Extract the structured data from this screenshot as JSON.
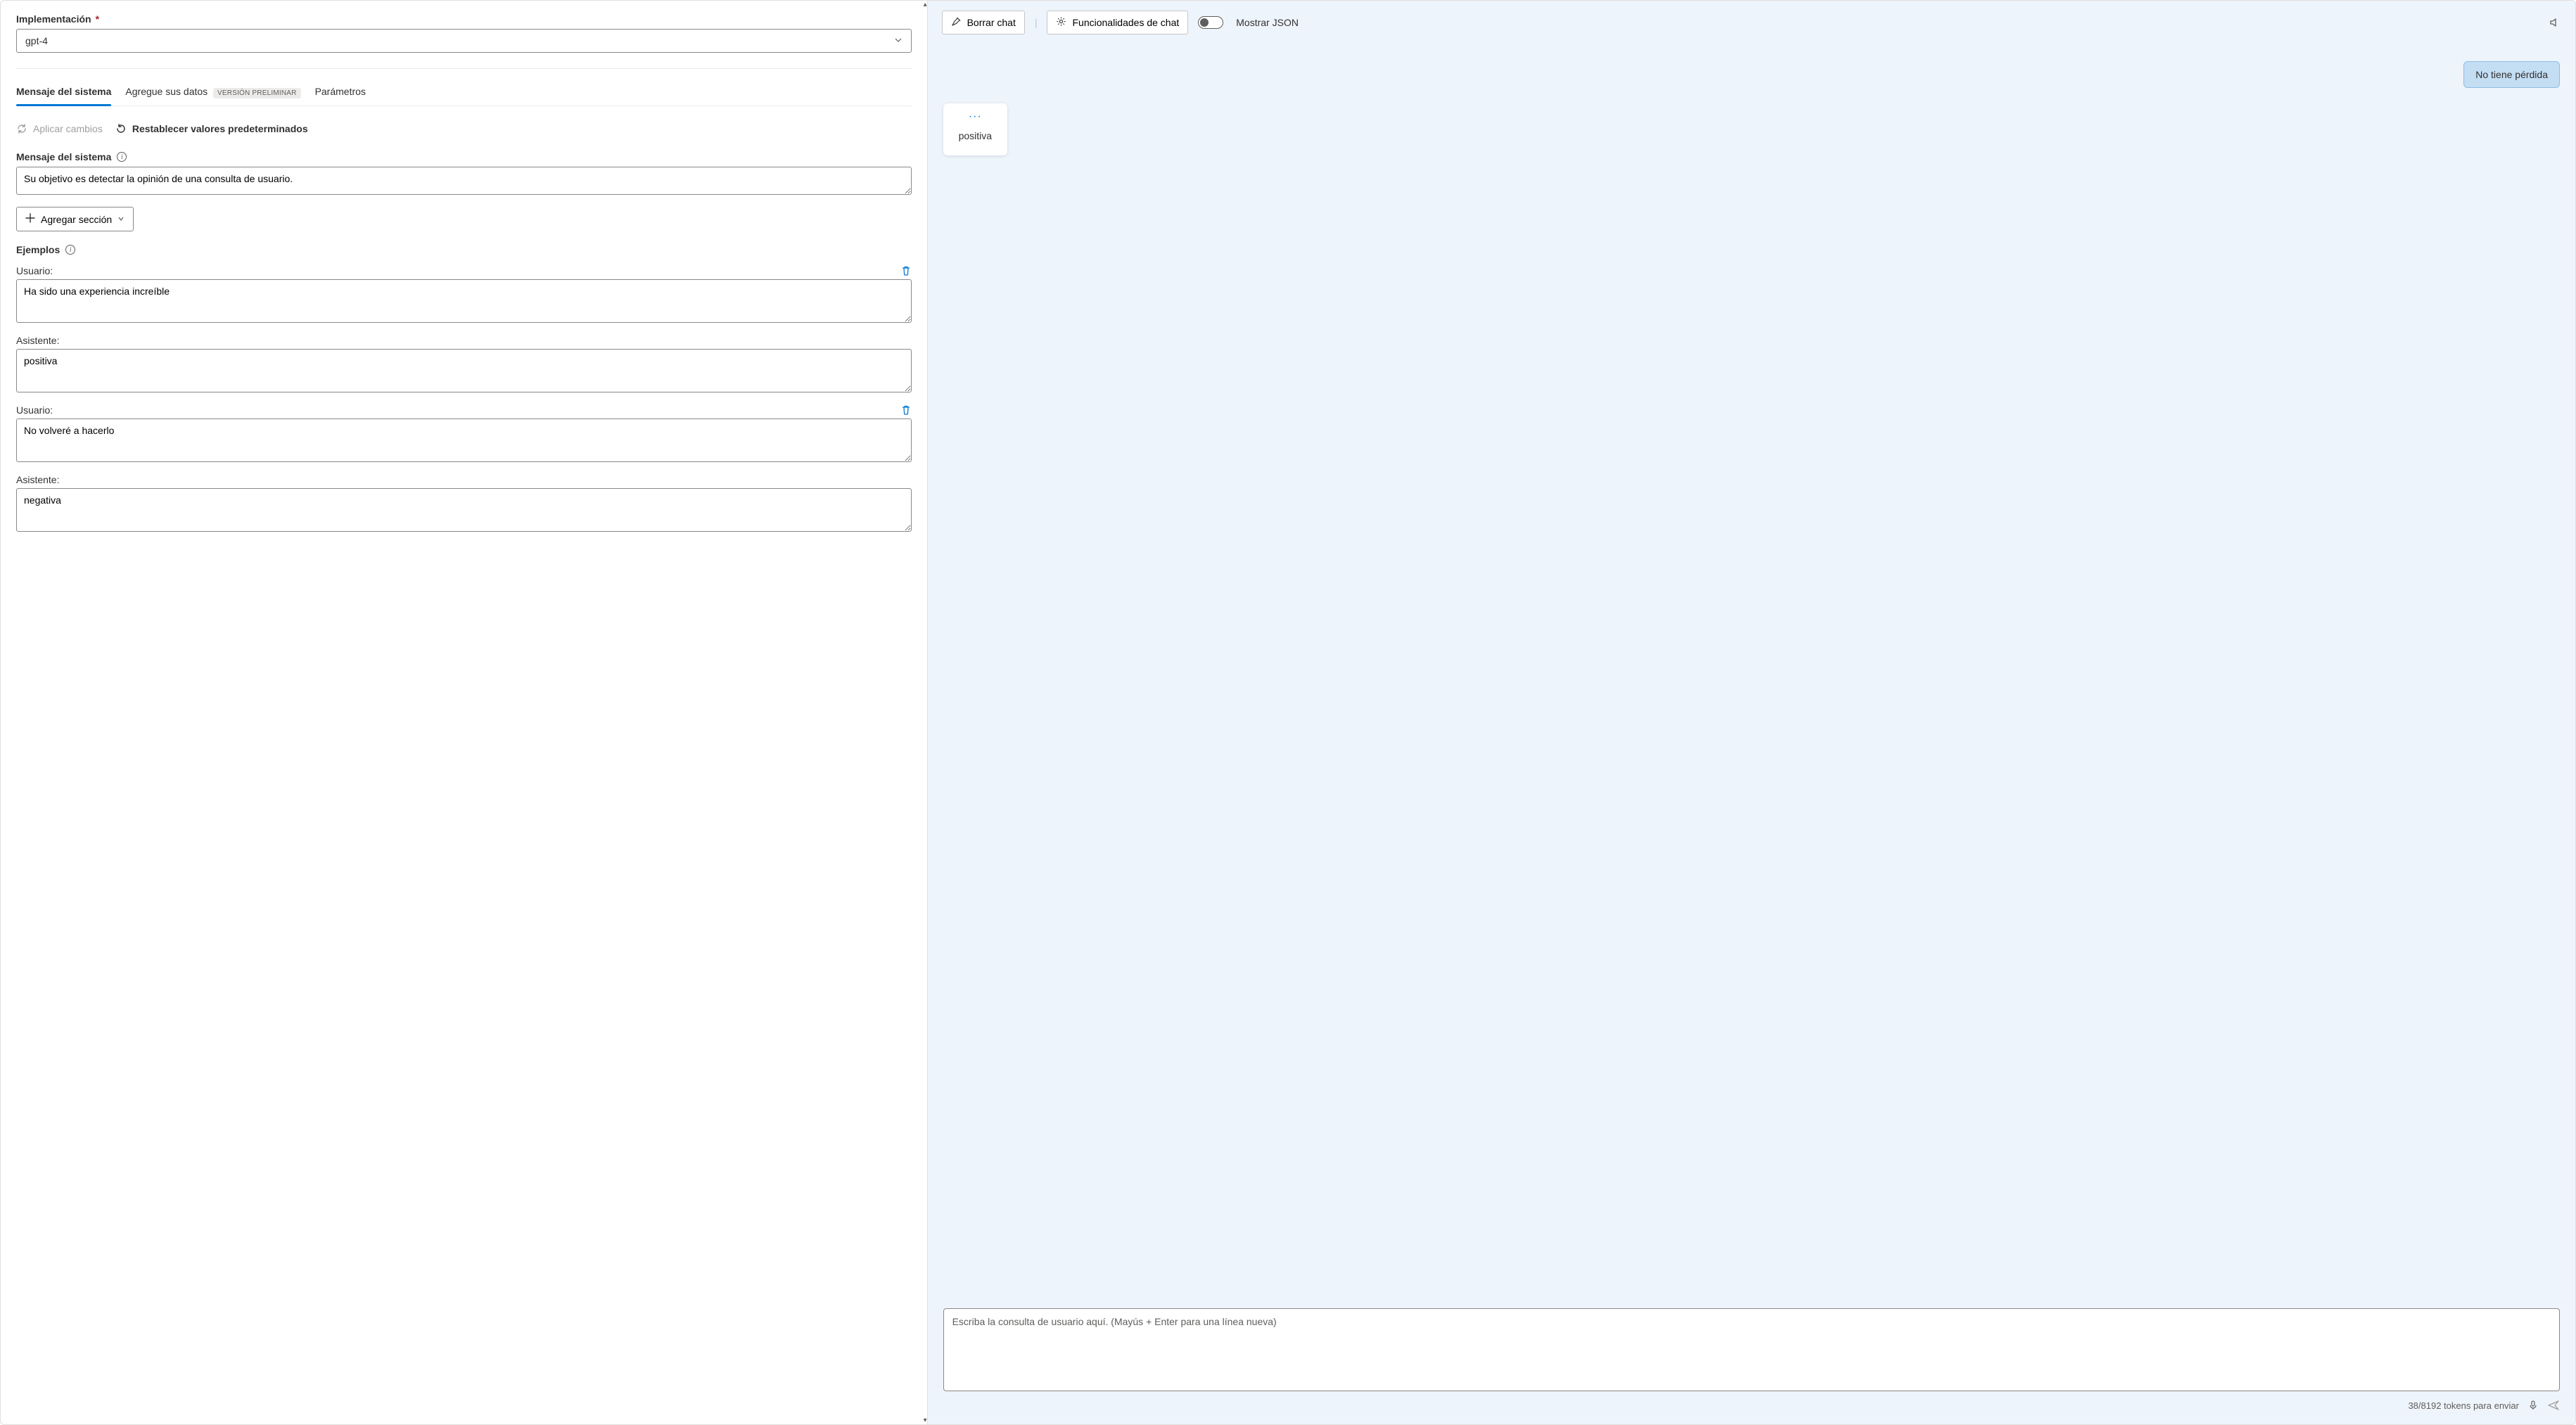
{
  "left": {
    "deployment_label": "Implementación",
    "deployment_required": "*",
    "deployment_value": "gpt-4",
    "tabs": [
      {
        "label": "Mensaje del sistema",
        "active": true
      },
      {
        "label": "Agregue sus datos",
        "badge": "VERSIÓN PRELIMINAR",
        "active": false
      },
      {
        "label": "Parámetros",
        "active": false
      }
    ],
    "apply_label": "Aplicar cambios",
    "reset_label": "Restablecer valores predeterminados",
    "system_msg_label": "Mensaje del sistema",
    "system_msg_value": "Su objetivo es detectar la opinión de una consulta de usuario.",
    "add_section_label": "Agregar sección",
    "examples_label": "Ejemplos",
    "role_user": "Usuario:",
    "role_assistant": "Asistente:",
    "examples": [
      {
        "user": "Ha sido una experiencia increíble",
        "assistant": "positiva"
      },
      {
        "user": "No volveré a hacerlo",
        "assistant": "negativa"
      }
    ]
  },
  "chat": {
    "clear_label": "Borrar chat",
    "features_label": "Funcionalidades de chat",
    "show_json_label": "Mostrar JSON",
    "user_msg": "No tiene pérdida",
    "assistant_msg": "positiva",
    "input_placeholder": "Escriba la consulta de usuario aquí. (Mayús + Enter para una línea nueva)",
    "token_status": "38/8192 tokens para enviar"
  }
}
